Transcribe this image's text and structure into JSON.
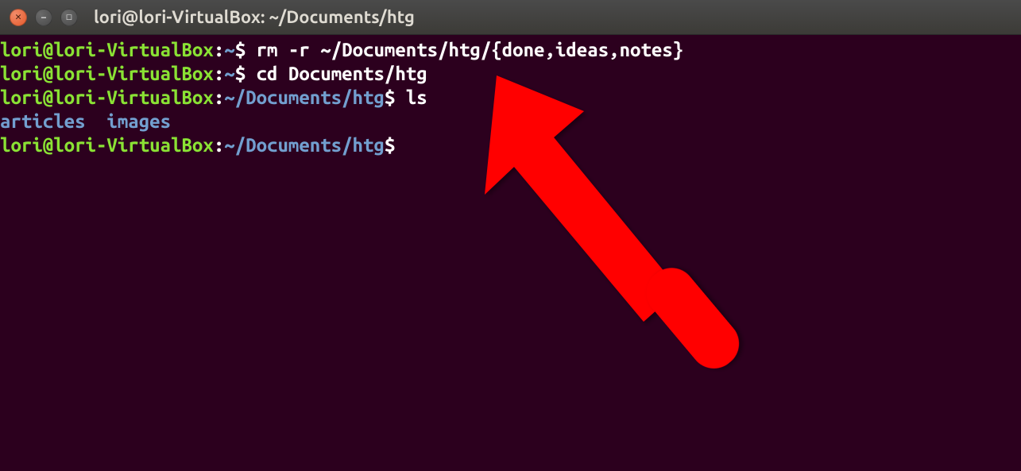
{
  "window": {
    "title": "lori@lori-VirtualBox: ~/Documents/htg"
  },
  "terminal": {
    "lines": [
      {
        "userHost": "lori@lori-VirtualBox",
        "colon": ":",
        "path": "~",
        "dollar": "$ ",
        "command": "rm -r ~/Documents/htg/{done,ideas,notes}"
      },
      {
        "userHost": "lori@lori-VirtualBox",
        "colon": ":",
        "path": "~",
        "dollar": "$ ",
        "command": "cd Documents/htg"
      },
      {
        "userHost": "lori@lori-VirtualBox",
        "colon": ":",
        "path": "~/Documents/htg",
        "dollar": "$ ",
        "command": "ls"
      }
    ],
    "output": "articles  images",
    "currentPrompt": {
      "userHost": "lori@lori-VirtualBox",
      "colon": ":",
      "path": "~/Documents/htg",
      "dollar": "$ "
    }
  },
  "annotation": {
    "arrowColor": "#ff0000"
  }
}
